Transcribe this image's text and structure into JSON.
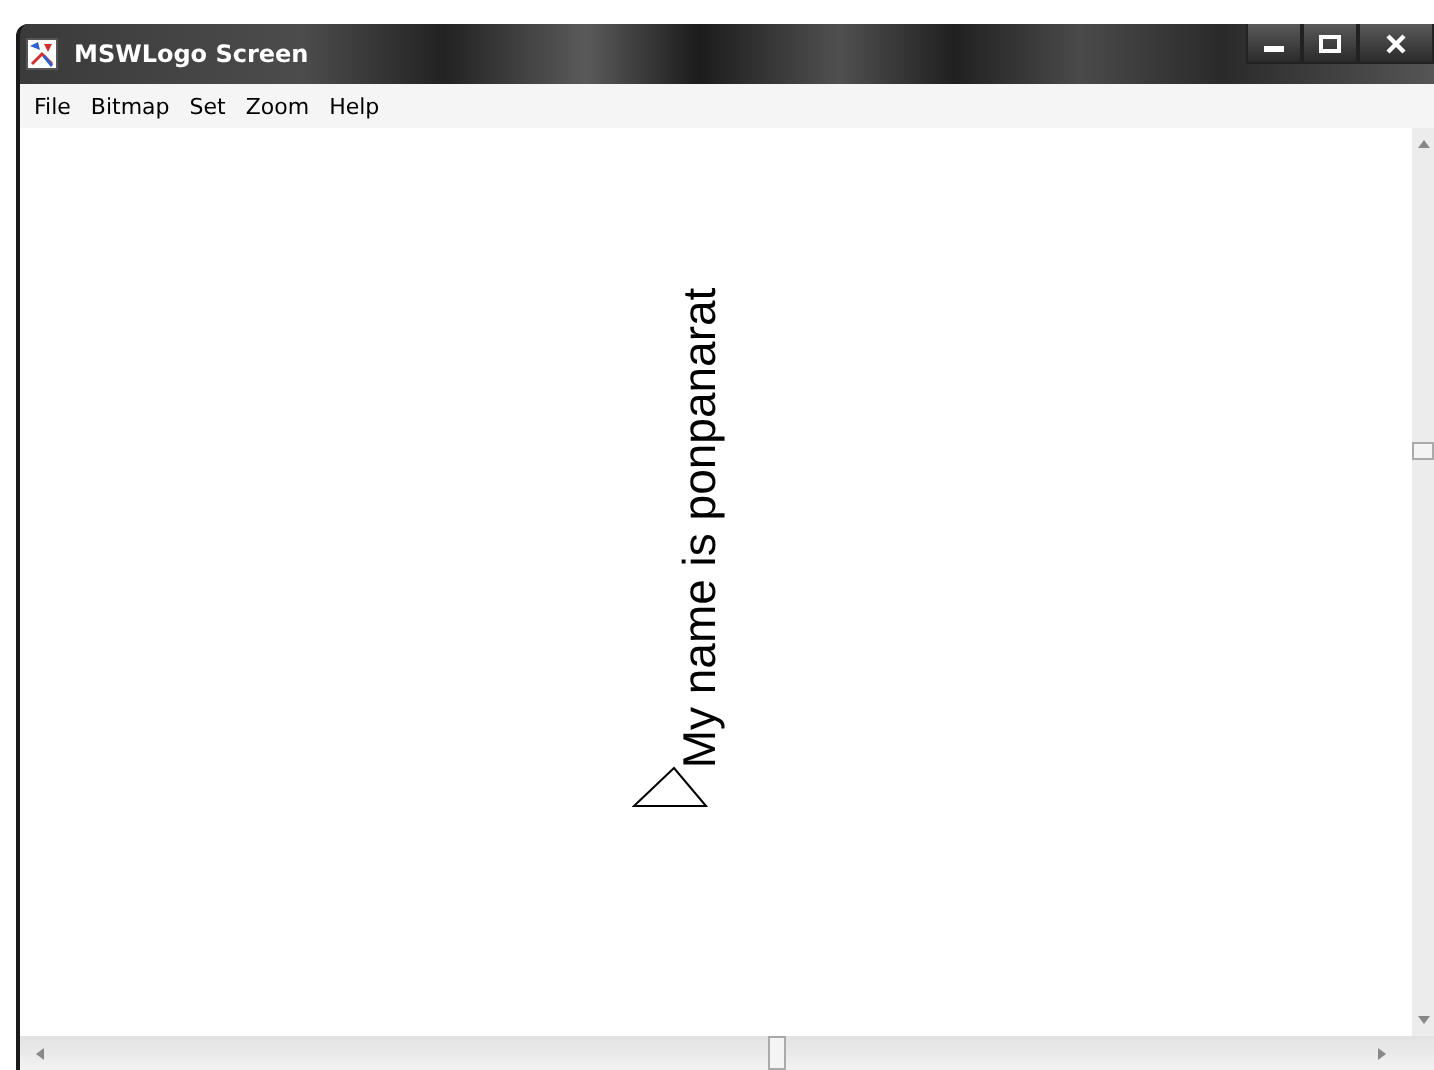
{
  "window": {
    "title": "MSWLogo Screen"
  },
  "menu": [
    "File",
    "Bitmap",
    "Set",
    "Zoom",
    "Help"
  ],
  "canvas": {
    "label": "My name is ponpanarat"
  }
}
